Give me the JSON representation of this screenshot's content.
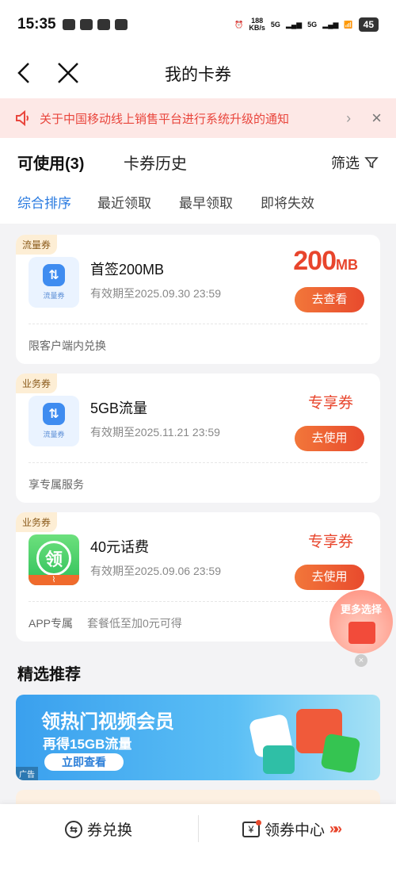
{
  "status_bar": {
    "time": "15:35",
    "speed_value": "188",
    "speed_unit": "KB/s",
    "sig1": "5G",
    "sig2": "5G",
    "battery": "45"
  },
  "nav": {
    "title": "我的卡券"
  },
  "notice": {
    "text": "关于中国移动线上销售平台进行系统升级的通知",
    "arrow": "›",
    "close": "×"
  },
  "tabs": {
    "active": "可使用(3)",
    "history": "卡券历史",
    "filter": "筛选"
  },
  "sorts": [
    "综合排序",
    "最近领取",
    "最早领取",
    "即将失效"
  ],
  "coupons": [
    {
      "tag": "流量券",
      "icon_label": "流量券",
      "name": "首签200MB",
      "expiry": "有效期至2025.09.30 23:59",
      "value_big": "200",
      "value_unit": "MB",
      "button": "去查看",
      "note": "限客户端内兑换"
    },
    {
      "tag": "业务券",
      "icon_label": "流量券",
      "name": "5GB流量",
      "expiry": "有效期至2025.11.21 23:59",
      "value_text": "专享券",
      "button": "去使用",
      "note": "享专属服务"
    },
    {
      "tag": "业务券",
      "icon_glyph": "领",
      "name": "40元话费",
      "expiry": "有效期至2025.09.06 23:59",
      "value_text": "专享券",
      "button": "去使用",
      "note": "APP专属",
      "note2": "套餐低至加0元可得"
    }
  ],
  "bubble": {
    "label": "更多选择"
  },
  "recommend": {
    "title": "精选推荐",
    "banner": {
      "headline": "领热门视频会员",
      "subline": "再得15GB流量",
      "button": "立即查看",
      "ad_tag": "广告"
    }
  },
  "bottom": {
    "exchange": "券兑换",
    "center": "领券中心",
    "center_arrows": "»»"
  },
  "colors": {
    "accent": "#e8452c",
    "active_sort": "#2b7be0",
    "notice_bg": "#fde8e6"
  }
}
